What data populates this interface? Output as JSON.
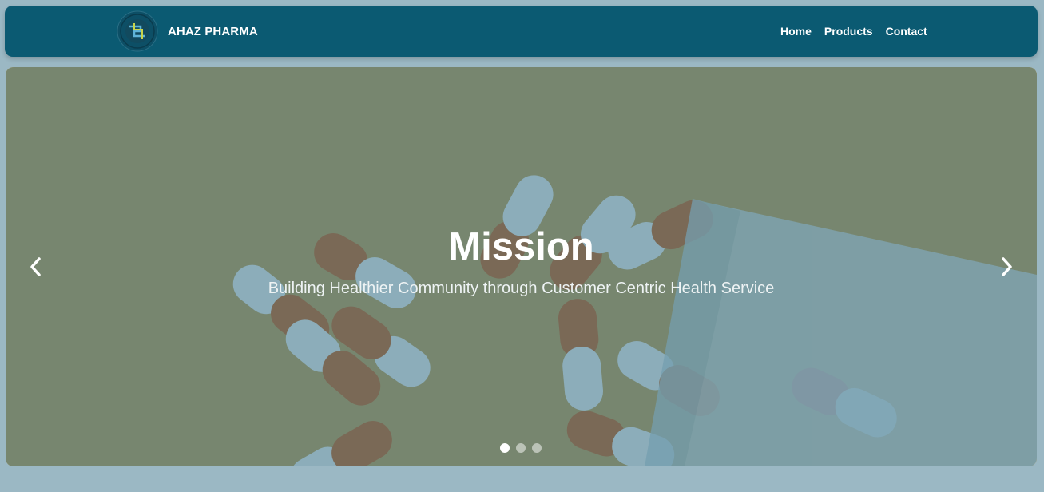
{
  "navbar": {
    "brand_name": "AHAZ PHARMA",
    "logo_icon": "ahaz-pharma-logo",
    "links": [
      "Home",
      "Products",
      "Contact"
    ],
    "background_color": "#0b5a72"
  },
  "hero": {
    "title": "Mission",
    "subtitle": "Building Healthier Community through Customer Centric Health Service",
    "prev_icon": "chevron-left-icon",
    "next_icon": "chevron-right-icon",
    "slide_count": 3,
    "active_slide": 1,
    "overlay_color": "#266782"
  }
}
